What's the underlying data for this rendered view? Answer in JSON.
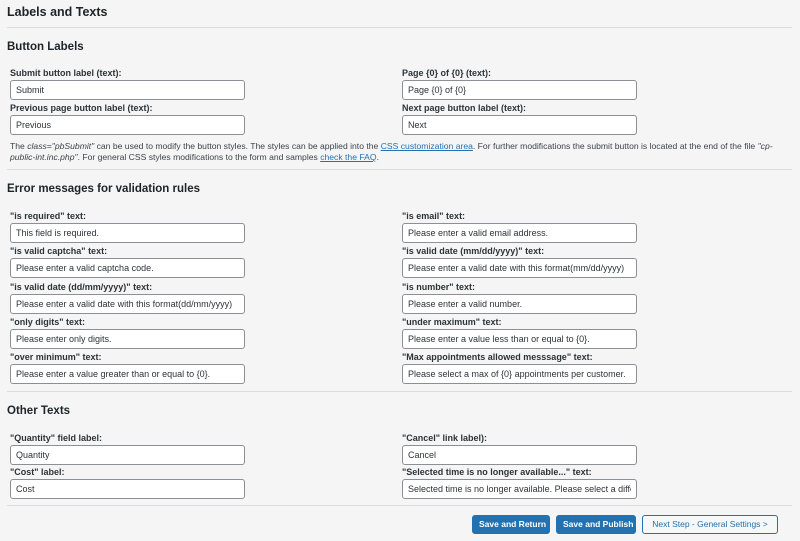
{
  "page_title": "Labels and Texts",
  "sections": {
    "button_labels": {
      "title": "Button Labels",
      "fields": {
        "submit": {
          "label": "Submit button label (text):",
          "value": "Submit"
        },
        "page_of": {
          "label": "Page {0} of {0} (text):",
          "value": "Page {0} of {0}"
        },
        "previous": {
          "label": "Previous page button label (text):",
          "value": "Previous"
        },
        "next": {
          "label": "Next page button label (text):",
          "value": "Next"
        }
      },
      "note": {
        "part1": "The ",
        "class_code": "class=\"pbSubmit\"",
        "part2": " can be used to modify the button styles. The styles can be applied into the ",
        "link1": "CSS customization area",
        "part3": ". For further modifications the submit button is located at the end of the file ",
        "file_code": "\"cp-public-int.inc.php\"",
        "part4": ". For general CSS styles modifications to the form and samples ",
        "link2": "check the FAQ",
        "part5": "."
      }
    },
    "error_messages": {
      "title": "Error messages for validation rules",
      "fields": {
        "is_required": {
          "label": "\"is required\" text:",
          "value": "This field is required."
        },
        "is_email": {
          "label": "\"is email\" text:",
          "value": "Please enter a valid email address."
        },
        "is_valid_captcha": {
          "label": "\"is valid captcha\" text:",
          "value": "Please enter a valid captcha code."
        },
        "is_valid_date_mdy": {
          "label": "\"is valid date (mm/dd/yyyy)\" text:",
          "value": "Please enter a valid date with this format(mm/dd/yyyy)"
        },
        "is_valid_date_dmy": {
          "label": "\"is valid date (dd/mm/yyyy)\" text:",
          "value": "Please enter a valid date with this format(dd/mm/yyyy)"
        },
        "is_number": {
          "label": "\"is number\" text:",
          "value": "Please enter a valid number."
        },
        "only_digits": {
          "label": "\"only digits\" text:",
          "value": "Please enter only digits."
        },
        "under_maximum": {
          "label": "\"under maximum\" text:",
          "value": "Please enter a value less than or equal to {0}."
        },
        "over_minimum": {
          "label": "\"over minimum\" text:",
          "value": "Please enter a value greater than or equal to {0}."
        },
        "max_appointments": {
          "label": "\"Max appointments allowed messsage\" text:",
          "value": "Please select a max of {0} appointments per customer."
        }
      }
    },
    "other_texts": {
      "title": "Other Texts",
      "fields": {
        "quantity": {
          "label": "\"Quantity\" field label:",
          "value": "Quantity"
        },
        "cancel": {
          "label": "\"Cancel\" link label):",
          "value": "Cancel"
        },
        "cost": {
          "label": "\"Cost\" label:",
          "value": "Cost"
        },
        "time_unavailable": {
          "label": "\"Selected time is no longer available...\" text:",
          "value": "Selected time is no longer available. Please select a different time."
        }
      }
    }
  },
  "footer": {
    "save_return": "Save and Return",
    "save_publish": "Save and Publish",
    "next_step": "Next Step - General Settings >"
  },
  "colors": {
    "primary": "#2271b1",
    "background": "#f5f5f5"
  }
}
